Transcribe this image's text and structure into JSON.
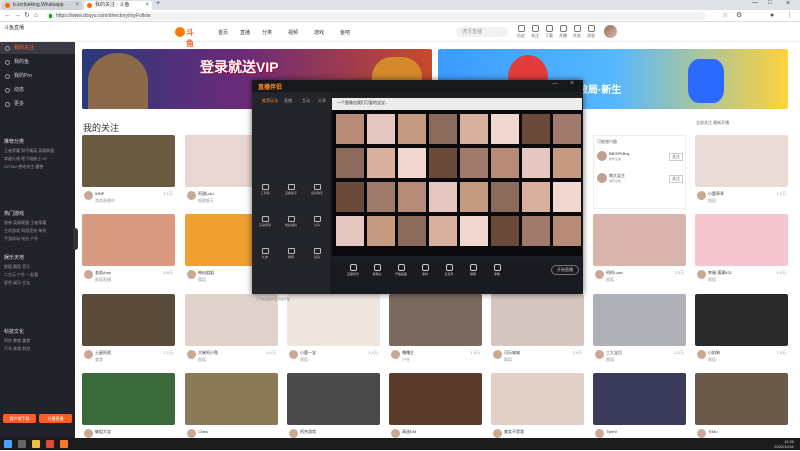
{
  "browser": {
    "tabs": [
      {
        "label": "b.scribeking.Whatsapp"
      },
      {
        "label": "我的关注 - 斗鱼"
      }
    ],
    "url": "https://www.douyu.com/directory/myFollow",
    "new_tab": "+"
  },
  "header": {
    "brand_top": "斗鱼直播",
    "logo": "斗鱼",
    "nav": [
      "首页",
      "直播",
      "分类",
      "视频",
      "游戏",
      "鱼吧"
    ],
    "search_placeholder": "虎牙直播",
    "icons": [
      {
        "name": "history-icon",
        "label": "历史"
      },
      {
        "name": "follow-icon",
        "label": "关注"
      },
      {
        "name": "download-icon",
        "label": "下载"
      },
      {
        "name": "live-icon",
        "label": "开播"
      },
      {
        "name": "task-icon",
        "label": "任务"
      },
      {
        "name": "message-icon",
        "label": "消息"
      }
    ]
  },
  "sidebar": {
    "top_items": [
      "我的关注",
      "我的鱼",
      "我的Pro",
      "动态",
      "更多"
    ],
    "sections": [
      {
        "title": "推荐分类",
        "rows": [
          "王者荣耀  和平精英  英雄联盟",
          "穿越火线  地下城勇士  CF",
          "DOTA2  绝地求生  魔兽"
        ]
      },
      {
        "title": "热门游戏",
        "rows": [
          "原神  英雄联盟  王者荣耀",
          "主机游戏  网游竞技  单机",
          "手游休闲  电台  户外"
        ]
      },
      {
        "title": "娱乐天地",
        "rows": [
          "颜值  舞蹈  音乐",
          "二次元  户外  一起看",
          "星秀  娱乐  交友"
        ]
      },
      {
        "title": "科技文化",
        "rows": [
          "科技  教育  美食",
          "汽车  体育  财经"
        ]
      }
    ],
    "buttons": [
      "客户端下载",
      "开播直播"
    ]
  },
  "main": {
    "banner1_text": "登录就送VIP",
    "banner2_text": "破局·新生",
    "follow_title": "我的关注",
    "sort_label": "全部关注  最新开播",
    "cards_row1": [
      {
        "name": "WNP",
        "views": "3.1万",
        "desc": "游戏直播中",
        "color": "#6a5a40"
      },
      {
        "name": "阿甜Lulu",
        "views": "2.8万",
        "desc": "唱歌聊天",
        "color": "#e8d6d0"
      },
      {
        "name": "",
        "views": "",
        "desc": "",
        "color": "#ffffff"
      },
      {
        "name": "",
        "views": "",
        "desc": "",
        "color": "#ffffff"
      },
      {
        "name": "",
        "views": "",
        "desc": "",
        "color": "#ffffff"
      },
      {
        "name": "",
        "views": "",
        "desc": "",
        "color": "#ffffff"
      },
      {
        "name": "小鹿乖乖",
        "views": "1.2万",
        "desc": "颜值",
        "color": "#e9dcd6"
      }
    ],
    "cards_row2": [
      {
        "name": "若若Amy",
        "views": "8.8万",
        "desc": "颜值直播",
        "color": "#d89a80"
      },
      {
        "name": "神仙姐姐",
        "views": "4.6万",
        "desc": "舞蹈",
        "color": "#f0a030"
      },
      {
        "name": "",
        "views": "",
        "desc": "",
        "color": "#ffffff"
      },
      {
        "name": "",
        "views": "",
        "desc": "",
        "color": "#ffffff"
      },
      {
        "name": "",
        "views": "",
        "desc": "",
        "color": "#ffffff"
      },
      {
        "name": "柯柯Luke",
        "views": "3.3万",
        "desc": "颜值",
        "color": "#d8b4ac"
      },
      {
        "name": "幸福 满满521",
        "views": "5.5万",
        "desc": "颜值",
        "color": "#f6c6d0"
      }
    ],
    "cards_row3": [
      {
        "name": "土豪阿斌",
        "views": "2.1万",
        "desc": "美食",
        "color": "#5a4a3a"
      },
      {
        "name": "大碗阿小兔",
        "views": "6.1万",
        "desc": "颜值",
        "color": "#e2d2cc"
      },
      {
        "name": "小鹿一宝",
        "views": "4.4万",
        "desc": "颜值",
        "color": "#f0e6e0"
      },
      {
        "name": "嘎嘎主",
        "views": "1.5万",
        "desc": "户外",
        "color": "#7a6a60"
      },
      {
        "name": "可乐喵喵",
        "views": "3.9万",
        "desc": "舞蹈",
        "color": "#d6c6c0"
      },
      {
        "name": "三九宝贝",
        "views": "2.2万",
        "desc": "颜值",
        "color": "#b0b0b8"
      },
      {
        "name": "小奶狗",
        "views": "7.0万",
        "desc": "颜值",
        "color": "#2a2a2a"
      }
    ],
    "cards_row4": [
      {
        "name": "御姐大宝",
        "views": "",
        "desc": "",
        "color": "#3a6a3a"
      },
      {
        "name": "CNeu",
        "views": "",
        "desc": "",
        "color": "#8a7a5a"
      },
      {
        "name": "阿杰游戏",
        "views": "",
        "desc": "",
        "color": "#4a4a4a"
      },
      {
        "name": "高迪DM",
        "views": "",
        "desc": "",
        "color": "#5a3a2a"
      },
      {
        "name": "美女不是我",
        "views": "",
        "desc": "",
        "color": "#e0d0c8"
      },
      {
        "name": "Tyler0",
        "views": "",
        "desc": "",
        "color": "#3a3a5a"
      },
      {
        "name": "卡Mu",
        "views": "",
        "desc": "",
        "color": "#6a5a4a"
      }
    ],
    "rec_panel": {
      "header": "可能感兴趣",
      "rows": [
        {
          "name": "BBGPKBoy",
          "sub": "推荐主播",
          "btn": "关注"
        },
        {
          "name": "南大吴主",
          "sub": "推荐主播",
          "btn": "关注"
        }
      ]
    }
  },
  "app": {
    "title": "直播伴侣",
    "tabs": [
      "推荐玩法",
      "直播",
      "互动",
      "分享"
    ],
    "tools": [
      "工具箱",
      "直播助手",
      "房管助手",
      "互动游戏",
      "粉丝福利",
      "分享",
      "礼物",
      "弹幕",
      "道具"
    ],
    "preview_title": "一个图像由我们可爱的宝宝...",
    "bottom_buttons": [
      "直播场景",
      "摄像头",
      "开始画面",
      "素材",
      "麦克风",
      "弹幕",
      "录像"
    ],
    "go_live": "开始直播",
    "footer": "已开启直播伴侣 自动开播"
  },
  "taskbar": {
    "time": "11:30",
    "date": "2022/10/11"
  }
}
